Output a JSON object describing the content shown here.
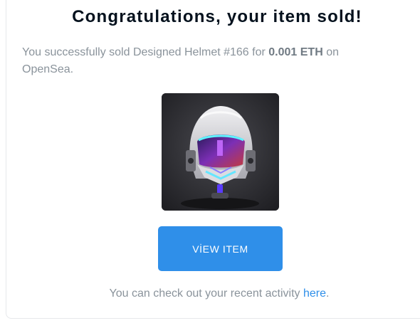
{
  "email": {
    "title": "Congratulations, your item sold!",
    "message_prefix": "You successfully sold Designed Helmet #166 for ",
    "price": "0.001 ETH",
    "message_suffix": " on OpenSea.",
    "item_image_icon": "helmet-nft-image",
    "view_button_label": "VİEW ITEM",
    "footer_prefix": "You can check out your recent activity ",
    "footer_link": "here",
    "footer_suffix": ".",
    "colors": {
      "accent": "#2f8fe9",
      "title": "#04111d",
      "body_text": "#8a939b"
    }
  }
}
